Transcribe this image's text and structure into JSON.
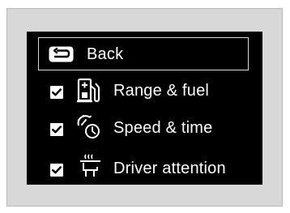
{
  "menu": {
    "back": {
      "label": "Back",
      "icon": "return-arrow-icon"
    },
    "items": [
      {
        "label": "Range & fuel",
        "checked": true,
        "icon": "fuel-pump-icon"
      },
      {
        "label": "Speed & time",
        "checked": true,
        "icon": "speed-clock-icon"
      },
      {
        "label": "Driver attention",
        "checked": true,
        "icon": "seat-heat-icon"
      }
    ]
  },
  "colors": {
    "screen_background": "#000000",
    "text": "#ffffff",
    "frame_background": "#d8d8d8",
    "frame_border": "#b8b8b8",
    "selection_border": "#d9d9d9"
  }
}
